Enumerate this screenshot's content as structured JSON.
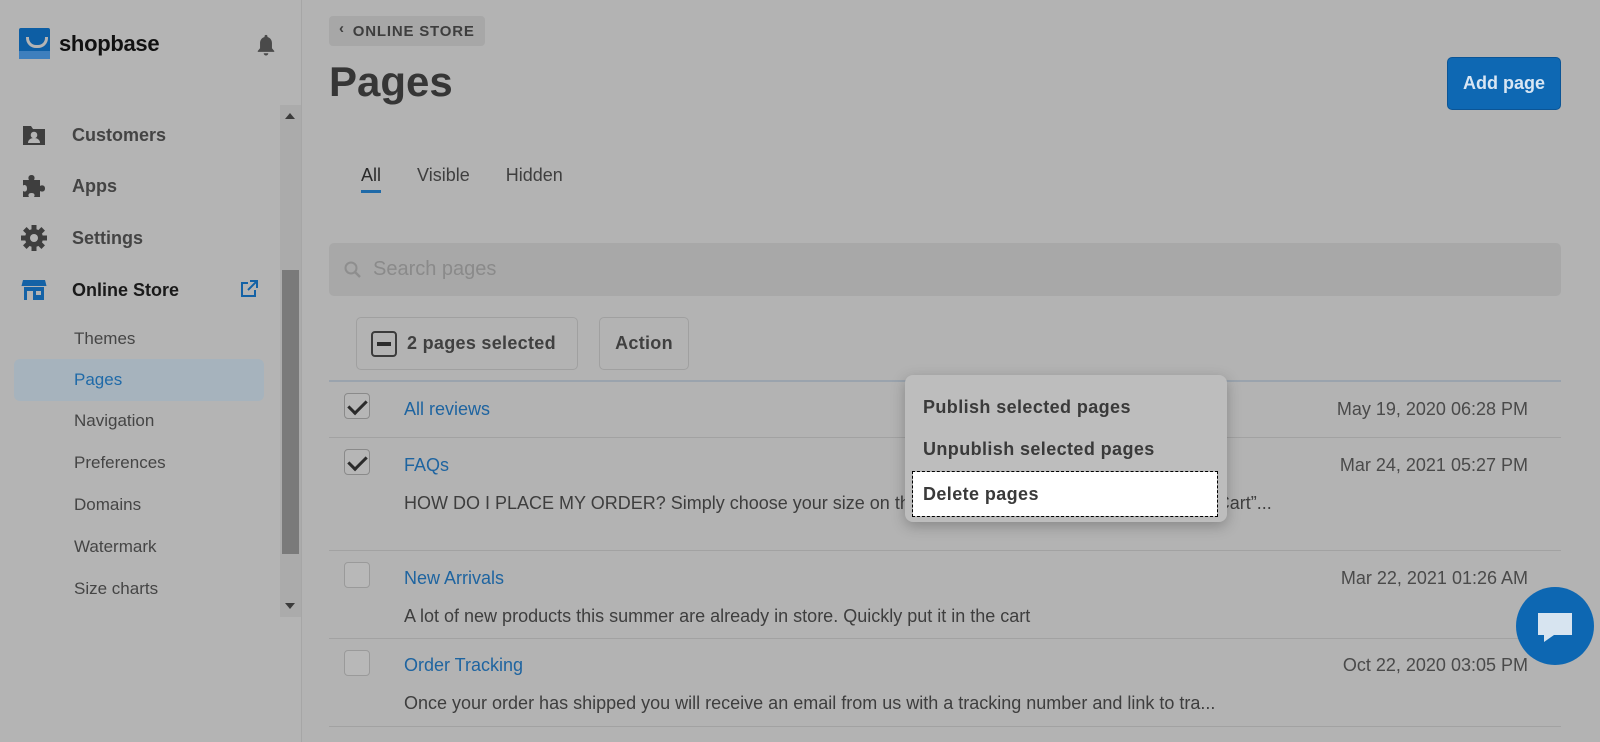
{
  "brand": {
    "name": "shopbase"
  },
  "sidebar": {
    "items": [
      {
        "label": "Customers",
        "icon": "customers-icon"
      },
      {
        "label": "Apps",
        "icon": "puzzle-icon"
      },
      {
        "label": "Settings",
        "icon": "gear-icon"
      },
      {
        "label": "Online Store",
        "icon": "store-icon"
      }
    ],
    "online_store_sub": [
      {
        "label": "Themes"
      },
      {
        "label": "Pages"
      },
      {
        "label": "Navigation"
      },
      {
        "label": "Preferences"
      },
      {
        "label": "Domains"
      },
      {
        "label": "Watermark"
      },
      {
        "label": "Size charts"
      }
    ]
  },
  "header": {
    "breadcrumb": "ONLINE STORE",
    "title": "Pages",
    "add_button": "Add page"
  },
  "tabs": [
    {
      "label": "All"
    },
    {
      "label": "Visible"
    },
    {
      "label": "Hidden"
    }
  ],
  "search": {
    "placeholder": "Search pages"
  },
  "bulk": {
    "selected_text": "2 pages selected",
    "action_label": "Action"
  },
  "dropdown": {
    "items": [
      {
        "label": "Publish selected pages"
      },
      {
        "label": "Unpublish selected pages"
      },
      {
        "label": "Delete pages"
      }
    ]
  },
  "pages": [
    {
      "title": "All reviews",
      "date": "May 19, 2020 06:28 PM",
      "excerpt": "",
      "checked": true
    },
    {
      "title": "FAQs",
      "date": "Mar 24, 2021 05:27 PM",
      "excerpt": "HOW DO I PLACE MY ORDER? Simply choose your size on the product page, then click the “Add To Cart”...",
      "checked": true
    },
    {
      "title": "New Arrivals",
      "date": "Mar 22, 2021 01:26 AM",
      "excerpt": "A lot of new products this summer are already in store. Quickly put it in the cart",
      "checked": false
    },
    {
      "title": "Order Tracking",
      "date": "Oct 22, 2020 03:05 PM",
      "excerpt": "Once your order has shipped you will receive an email from us with a tracking number and link to tra...",
      "checked": false
    }
  ],
  "colors": {
    "accent": "#0e68b3",
    "link": "#1e64a0",
    "overlay_bg": "#b3b3b3"
  }
}
